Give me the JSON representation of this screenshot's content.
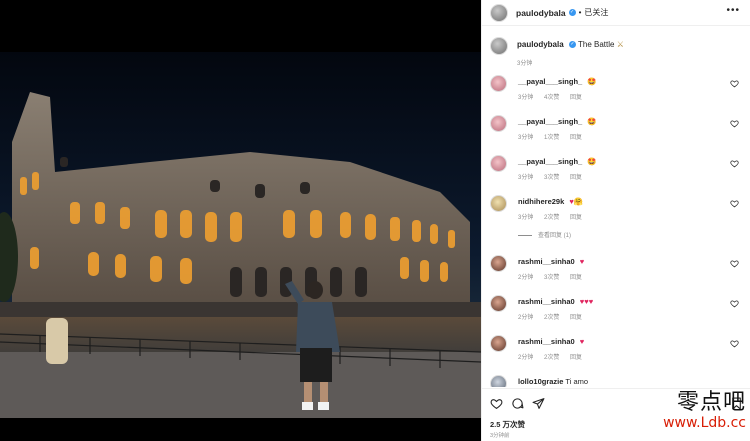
{
  "post": {
    "username": "paulodybala",
    "follow_state": "已关注",
    "more": "•••",
    "caption_text": "The Battle",
    "caption_emoji": "⚔",
    "caption_time": "3分钟"
  },
  "comments": [
    {
      "user": "__payal___singh_",
      "emoji": "🤩",
      "time": "3分钟",
      "likes": "4次赞",
      "reply": "回复"
    },
    {
      "user": "__payal___singh_",
      "emoji": "🤩",
      "time": "3分钟",
      "likes": "1次赞",
      "reply": "回复"
    },
    {
      "user": "__payal___singh_",
      "emoji": "🤩",
      "time": "3分钟",
      "likes": "3次赞",
      "reply": "回复"
    },
    {
      "user": "nidhihere29k",
      "emoji": "♥🤗",
      "time": "3分钟",
      "likes": "2次赞",
      "reply": "回复",
      "view_replies": "查看回复 (1)"
    },
    {
      "user": "rashmi__sinha0",
      "emoji": "♥",
      "time": "2分钟",
      "likes": "3次赞",
      "reply": "回复"
    },
    {
      "user": "rashmi__sinha0",
      "emoji": "♥♥♥",
      "time": "2分钟",
      "likes": "2次赞",
      "reply": "回复"
    },
    {
      "user": "rashmi__sinha0",
      "emoji": "♥",
      "time": "2分钟",
      "likes": "2次赞",
      "reply": "回复"
    },
    {
      "user": "lollo10grazie",
      "text": "Ti amo"
    }
  ],
  "actions": {
    "likes_count": "2.5 万次赞",
    "post_time": "3分钟前"
  },
  "watermark": {
    "cn": "零点吧",
    "url": "www.Ldb.cc"
  }
}
